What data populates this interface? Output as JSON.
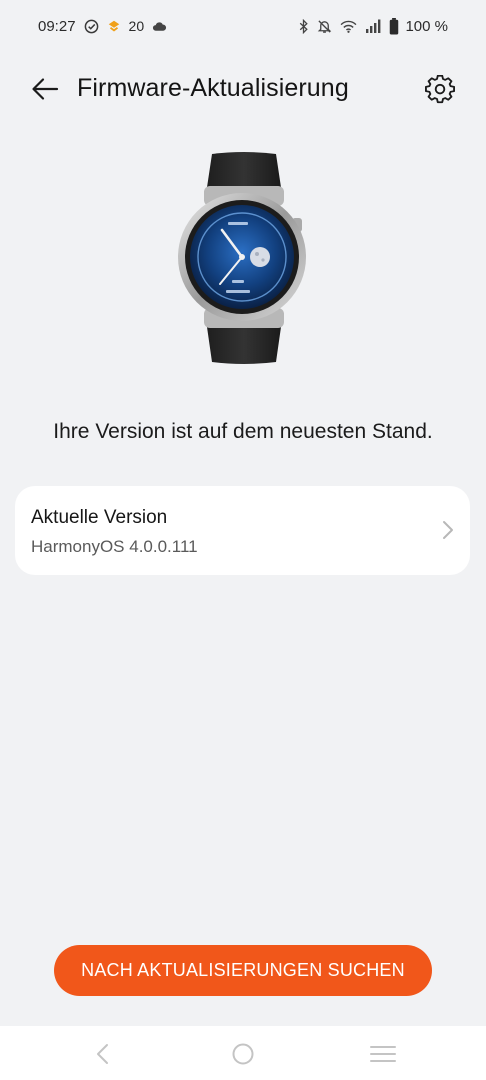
{
  "status_bar": {
    "time": "09:27",
    "temperature": "20",
    "battery_percent": "100 %",
    "icons": [
      "check-circle-icon",
      "notification-app-icon",
      "cloud-icon",
      "bluetooth-icon",
      "mute-icon",
      "wifi-icon",
      "signal-icon",
      "battery-icon"
    ]
  },
  "header": {
    "title": "Firmware-Aktualisierung",
    "back_icon": "arrow-left-icon",
    "settings_icon": "gear-icon"
  },
  "device": {
    "image": "smartwatch-image"
  },
  "status_message": "Ihre Version ist auf dem neuesten Stand.",
  "version_card": {
    "label": "Aktuelle Version",
    "value": "HarmonyOS 4.0.0.111"
  },
  "check_button": {
    "label": "NACH AKTUALISIERUNGEN SUCHEN"
  },
  "navigation_bar": {
    "icons": [
      "nav-back-icon",
      "nav-home-icon",
      "nav-menu-icon"
    ]
  },
  "colors": {
    "accent": "#f1571a",
    "background": "#f1f2f4",
    "card": "#ffffff"
  }
}
